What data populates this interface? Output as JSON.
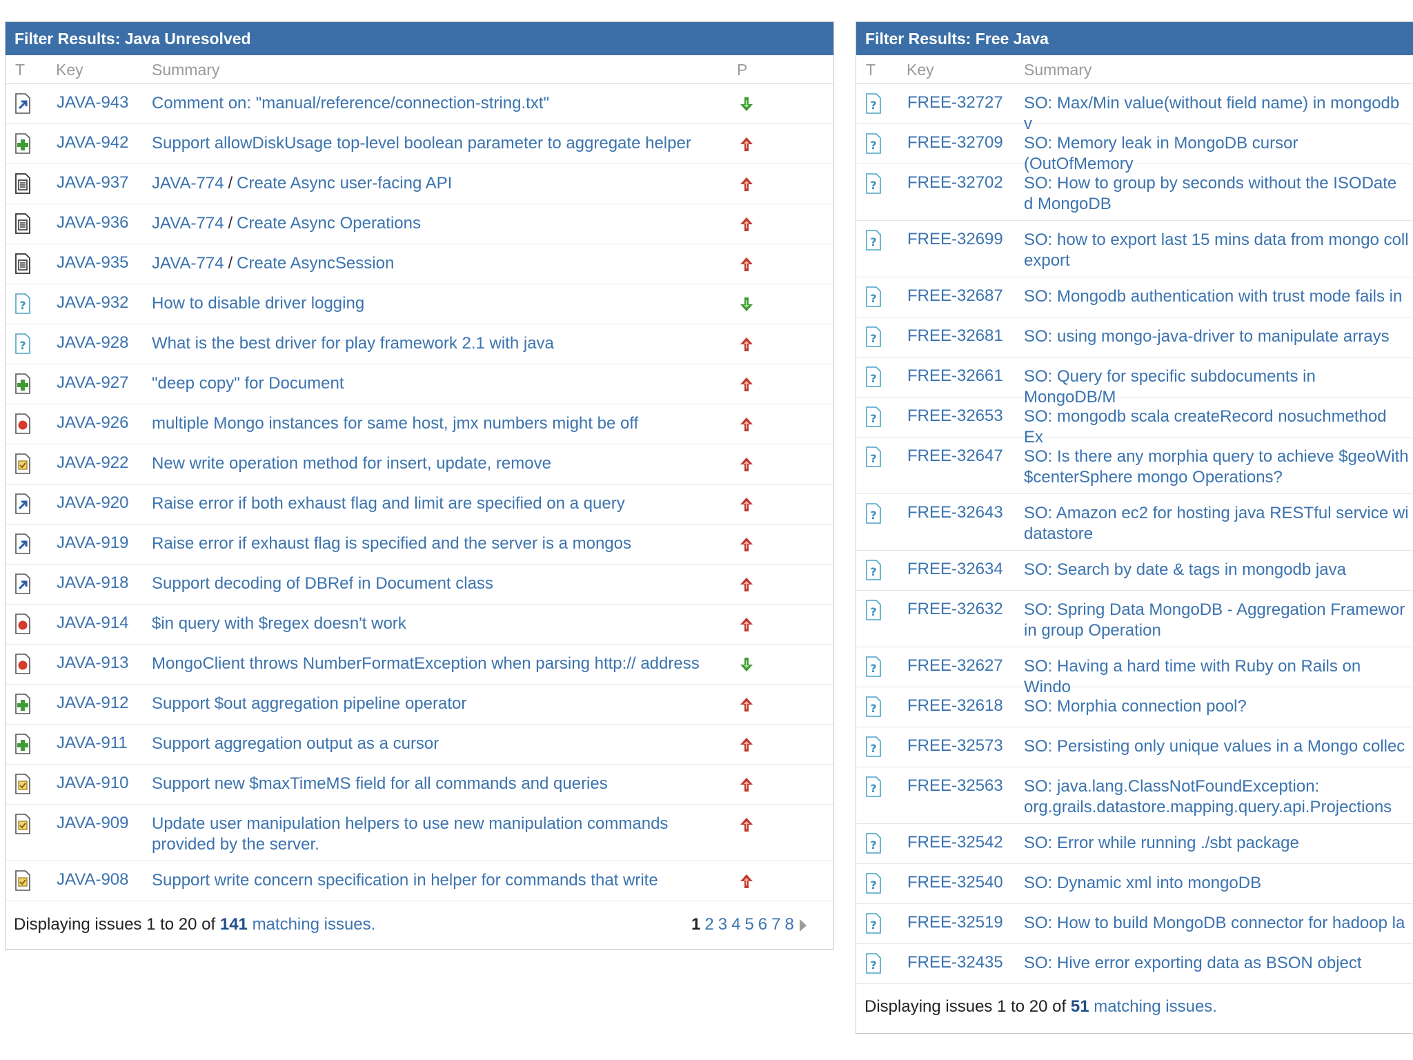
{
  "panel_left": {
    "title": "Filter Results: Java Unresolved",
    "columns": {
      "type": "T",
      "key": "Key",
      "summary": "Summary",
      "priority": "P"
    },
    "rows": [
      {
        "icon": "improvement",
        "key": "JAVA-943",
        "summary": "Comment on: \"manual/reference/connection-string.txt\"",
        "priority": "down"
      },
      {
        "icon": "new-feature",
        "key": "JAVA-942",
        "summary": "Support allowDiskUsage top-level boolean parameter to aggregate helper",
        "priority": "up"
      },
      {
        "icon": "subtask",
        "key": "JAVA-937",
        "parent": "JAVA-774",
        "summary": "Create Async user-facing API",
        "priority": "up"
      },
      {
        "icon": "subtask",
        "key": "JAVA-936",
        "parent": "JAVA-774",
        "summary": "Create Async Operations",
        "priority": "up"
      },
      {
        "icon": "subtask",
        "key": "JAVA-935",
        "parent": "JAVA-774",
        "summary": "Create AsyncSession",
        "priority": "up"
      },
      {
        "icon": "question",
        "key": "JAVA-932",
        "summary": "How to disable driver logging",
        "priority": "down"
      },
      {
        "icon": "question",
        "key": "JAVA-928",
        "summary": "What is the best driver for play framework 2.1 with java",
        "priority": "up"
      },
      {
        "icon": "new-feature",
        "key": "JAVA-927",
        "summary": "\"deep copy\" for Document",
        "priority": "up"
      },
      {
        "icon": "bug",
        "key": "JAVA-926",
        "summary": "multiple Mongo instances for same host, jmx numbers might be off",
        "priority": "up"
      },
      {
        "icon": "task",
        "key": "JAVA-922",
        "summary": "New write operation method for insert, update, remove",
        "priority": "up"
      },
      {
        "icon": "improvement",
        "key": "JAVA-920",
        "summary": "Raise error if both exhaust flag and limit are specified on a query",
        "priority": "up"
      },
      {
        "icon": "improvement",
        "key": "JAVA-919",
        "summary": "Raise error if exhaust flag is specified and the server is a mongos",
        "priority": "up"
      },
      {
        "icon": "improvement",
        "key": "JAVA-918",
        "summary": "Support decoding of DBRef in Document class",
        "priority": "up"
      },
      {
        "icon": "bug",
        "key": "JAVA-914",
        "summary": "$in query with $regex doesn't work",
        "priority": "up"
      },
      {
        "icon": "bug",
        "key": "JAVA-913",
        "summary": "MongoClient throws NumberFormatException when parsing http:// address",
        "priority": "down"
      },
      {
        "icon": "new-feature",
        "key": "JAVA-912",
        "summary": "Support $out aggregation pipeline operator",
        "priority": "up"
      },
      {
        "icon": "new-feature",
        "key": "JAVA-911",
        "summary": "Support aggregation output as a cursor",
        "priority": "up"
      },
      {
        "icon": "task",
        "key": "JAVA-910",
        "summary": "Support new $maxTimeMS field for all commands and queries",
        "priority": "up"
      },
      {
        "icon": "task",
        "key": "JAVA-909",
        "summary": "Update user manipulation helpers to use new manipulation commands provided by the server.",
        "priority": "up"
      },
      {
        "icon": "task",
        "key": "JAVA-908",
        "summary": "Support write concern specification in helper for commands that write",
        "priority": "up"
      }
    ],
    "footer": {
      "prefix": "Displaying issues 1 to 20 of",
      "count": "141",
      "suffix": "matching issues."
    },
    "pager": [
      "1",
      "2",
      "3",
      "4",
      "5",
      "6",
      "7",
      "8"
    ]
  },
  "panel_right": {
    "title": "Filter Results: Free Java",
    "columns": {
      "type": "T",
      "key": "Key",
      "summary": "Summary"
    },
    "rows": [
      {
        "icon": "question",
        "key": "FREE-32727",
        "summary": "SO: Max/Min value(without field name) in mongodb v"
      },
      {
        "icon": "question",
        "key": "FREE-32709",
        "summary": "SO: Memory leak in MongoDB cursor (OutOfMemory"
      },
      {
        "icon": "question",
        "key": "FREE-32702",
        "summary": "SO: How to group by seconds without the ISODate d MongoDB"
      },
      {
        "icon": "question",
        "key": "FREE-32699",
        "summary": "SO: how to export last 15 mins data from mongo coll export"
      },
      {
        "icon": "question",
        "key": "FREE-32687",
        "summary": "SO: Mongodb authentication with trust mode fails in"
      },
      {
        "icon": "question",
        "key": "FREE-32681",
        "summary": "SO: using mongo-java-driver to manipulate arrays"
      },
      {
        "icon": "question",
        "key": "FREE-32661",
        "summary": "SO: Query for specific subdocuments in MongoDB/M"
      },
      {
        "icon": "question",
        "key": "FREE-32653",
        "summary": "SO: mongodb scala createRecord nosuchmethod Ex"
      },
      {
        "icon": "question",
        "key": "FREE-32647",
        "summary": "SO: Is there any morphia query to achieve $geoWith $centerSphere mongo Operations?"
      },
      {
        "icon": "question",
        "key": "FREE-32643",
        "summary": "SO: Amazon ec2 for hosting java RESTful service wi datastore"
      },
      {
        "icon": "question",
        "key": "FREE-32634",
        "summary": "SO: Search by date & tags in mongodb java"
      },
      {
        "icon": "question",
        "key": "FREE-32632",
        "summary": "SO: Spring Data MongoDB - Aggregation Framewor in group Operation"
      },
      {
        "icon": "question",
        "key": "FREE-32627",
        "summary": "SO: Having a hard time with Ruby on Rails on Windo"
      },
      {
        "icon": "question",
        "key": "FREE-32618",
        "summary": "SO: Morphia connection pool?"
      },
      {
        "icon": "question",
        "key": "FREE-32573",
        "summary": "SO: Persisting only unique values in a Mongo collec"
      },
      {
        "icon": "question",
        "key": "FREE-32563",
        "summary": "SO: java.lang.ClassNotFoundException: org.grails.datastore.mapping.query.api.Projections"
      },
      {
        "icon": "question",
        "key": "FREE-32542",
        "summary": "SO: Error while running ./sbt package"
      },
      {
        "icon": "question",
        "key": "FREE-32540",
        "summary": "SO: Dynamic xml into mongoDB"
      },
      {
        "icon": "question",
        "key": "FREE-32519",
        "summary": "SO: How to build MongoDB connector for hadoop la"
      },
      {
        "icon": "question",
        "key": "FREE-32435",
        "summary": "SO: Hive error exporting data as BSON object"
      }
    ],
    "footer": {
      "prefix": "Displaying issues 1 to 20 of",
      "count": "51",
      "suffix": "matching issues."
    }
  },
  "colors": {
    "header_bg": "#3c6fa7",
    "link": "#3b73af",
    "priority_up": "#c0392b",
    "priority_down": "#3a9b2e"
  }
}
